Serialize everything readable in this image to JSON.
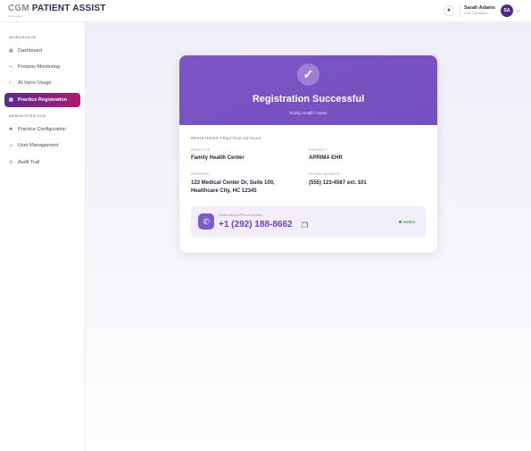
{
  "header": {
    "brand_prefix": "CGM",
    "brand_main": "PATIENT ASSIST",
    "brand_sub": "Wake Agent",
    "notification_icon": "bell-icon",
    "user_name": "Sarah Adams",
    "user_role": "CGM Operations",
    "user_initials": "SA"
  },
  "sidebar": {
    "workspace_label": "WORKSPACE",
    "admin_label": "ADMINISTRATION",
    "items": [
      {
        "label": "Dashboard",
        "icon": "grid-icon"
      },
      {
        "label": "Process Monitoring",
        "icon": "pulse-icon"
      },
      {
        "label": "AI Voice Usage",
        "icon": "wave-icon"
      },
      {
        "label": "Practice Registration",
        "icon": "clipboard-icon",
        "active": true
      },
      {
        "label": "Practice Configuration",
        "icon": "settings-icon"
      },
      {
        "label": "User Management",
        "icon": "users-icon"
      },
      {
        "label": "Audit Trail",
        "icon": "clock-icon"
      }
    ]
  },
  "card": {
    "title": "Registration Successful",
    "subtitle": "Family Health Center",
    "section_title": "REGISTERED PRACTICE DETAILS",
    "practice_label": "PRACTICE",
    "practice_value": "Family Health Center",
    "product_label": "PRODUCT",
    "product_value": "APRIMA EHR",
    "address_label": "ADDRESS",
    "address_line1": "123 Medical Center Dr, Suite 100,",
    "address_line2": "Healthcare City, HC 12345",
    "phone_label": "PHONE NUMBER",
    "phone_value": "(555) 123-4567  ext. 101",
    "assist_label": "Patient Assist Phone Number",
    "assist_number": "+1 (292) 188-8662",
    "status": "Active"
  },
  "colors": {
    "accent": "#7450bf",
    "active_nav_start": "#5b2a8e",
    "active_nav_end": "#b01a6e",
    "status_green": "#2faa55"
  }
}
